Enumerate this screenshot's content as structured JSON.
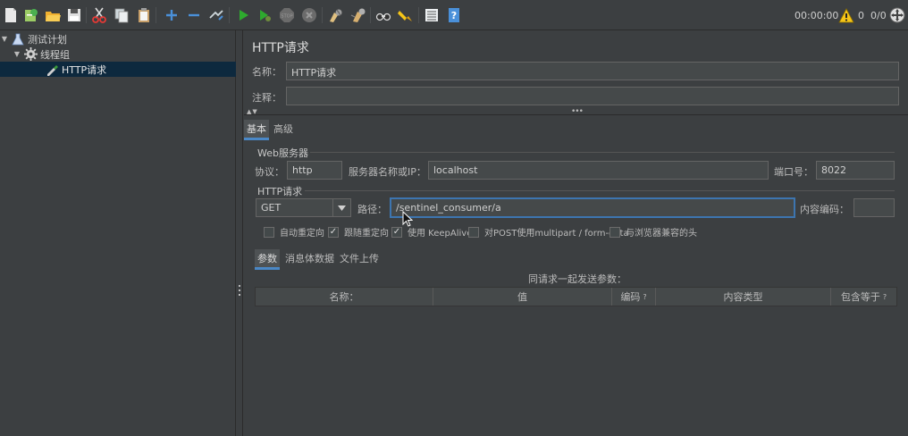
{
  "toolbar": {
    "icons": [
      "new-icon",
      "templates-icon",
      "open-icon",
      "save-icon",
      "cut-icon",
      "copy-icon",
      "paste-icon",
      "expand-icon",
      "collapse-icon",
      "toggle-icon",
      "start-icon",
      "start-no-pause-icon",
      "stop-icon",
      "shutdown-icon",
      "clear-icon",
      "clear-all-icon",
      "search-icon",
      "reset-search-icon",
      "function-helper-icon",
      "help-icon"
    ],
    "timer": "00:00:00",
    "warning_count": "0",
    "threads": "0/0"
  },
  "tree": {
    "items": [
      {
        "label": "测试计划",
        "icon": "test-plan-icon"
      },
      {
        "label": "线程组",
        "icon": "thread-group-icon"
      },
      {
        "label": "HTTP请求",
        "icon": "sampler-pipette-icon"
      }
    ]
  },
  "panel": {
    "title": "HTTP请求",
    "name_label": "名称：",
    "name_value": "HTTP请求",
    "comment_label": "注释：",
    "comment_value": "",
    "tabs": [
      "基本",
      "高级"
    ],
    "web_server": {
      "group_label": "Web服务器",
      "protocol_label": "协议：",
      "protocol_value": "http",
      "server_label": "服务器名称或IP：",
      "server_value": "localhost",
      "port_label": "端口号：",
      "port_value": "8022"
    },
    "http_request": {
      "group_label": "HTTP请求",
      "method": "GET",
      "path_label": "路径：",
      "path_value": "/sentinel_consumer/a",
      "encoding_label": "内容编码：",
      "encoding_value": ""
    },
    "checkboxes": [
      {
        "label": "自动重定向",
        "checked": false
      },
      {
        "label": "跟随重定向",
        "checked": true
      },
      {
        "label": "使用 KeepAlive",
        "checked": true
      },
      {
        "label": "对POST使用multipart / form-data",
        "checked": false
      },
      {
        "label": "与浏览器兼容的头",
        "checked": false
      }
    ],
    "sub_tabs": [
      "参数",
      "消息体数据",
      "文件上传"
    ],
    "params_caption": "同请求一起发送参数：",
    "columns": [
      "名称：",
      "值",
      "编码",
      "内容类型",
      "包含等于"
    ],
    "column_help_mark": "?"
  }
}
